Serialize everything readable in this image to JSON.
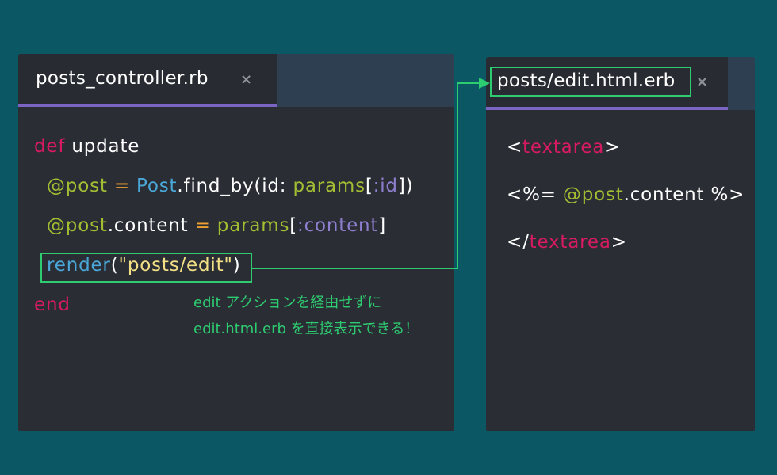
{
  "left_editor": {
    "tab_title": "posts_controller.rb",
    "tab_close": "×",
    "code": {
      "line1": {
        "keyword": "def",
        "method": "update"
      },
      "line2": {
        "ivar": "@post",
        "op": "=",
        "class": "Post",
        "call": ".find_by(id: ",
        "params": "params",
        "open": "[",
        "symbol": ":id",
        "close": "])"
      },
      "line3": {
        "ivar": "@post",
        "rest": ".content",
        "op": "=",
        "params": "params",
        "open": "[",
        "symbol": ":content",
        "close": "]"
      },
      "line4": {
        "method": "render",
        "open": "(",
        "string": "\"posts/edit\"",
        "close": ")"
      },
      "line5": {
        "keyword": "end"
      }
    },
    "note_line1": "edit アクションを経由せずに",
    "note_line2": "edit.html.erb を直接表示できる！"
  },
  "right_editor": {
    "tab_title": "posts/edit.html.erb",
    "tab_close": "×",
    "code": {
      "line1": {
        "lt": "<",
        "tag": "textarea",
        "gt": ">"
      },
      "line2": {
        "open": "<%= ",
        "ivar": "@post",
        "rest": ".content %>"
      },
      "line3": {
        "lt": "</",
        "tag": "textarea",
        "gt": ">"
      }
    }
  },
  "colors": {
    "background": "#0b5764",
    "panel": "#2a2d34",
    "tab_underline": "#7b64c3",
    "highlight": "#2ecc71"
  }
}
